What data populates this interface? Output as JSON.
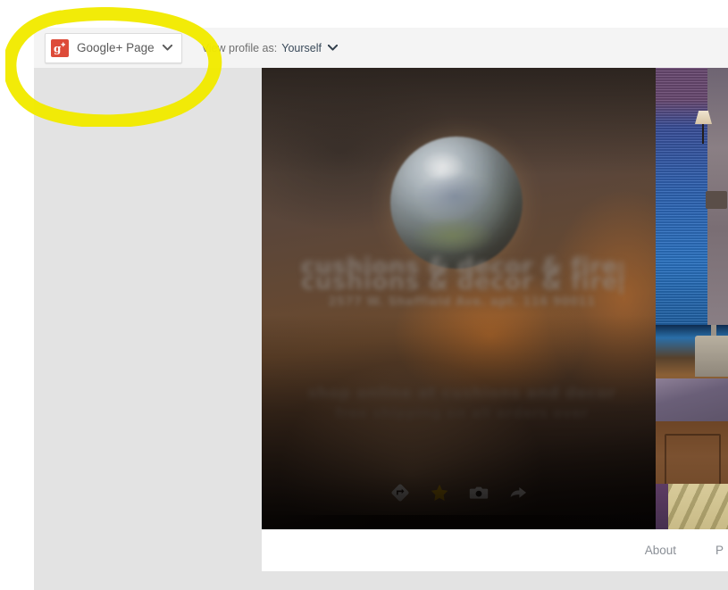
{
  "topbar": {
    "account_chip": {
      "label": "Google+ Page",
      "icon": "google-plus-icon",
      "chevron": "chevron-down-icon"
    },
    "view_profile": {
      "label": "View profile as:",
      "value": "Yourself",
      "chevron": "chevron-down-icon"
    }
  },
  "cover": {
    "watermark_lines": [
      "cushions & decor & fireplaces",
      "cushions & decor & fireplaces",
      "2577 W. Sheffield Ave. apt. 116 90011",
      "shop online at cushions and decor",
      "free shipping on all orders over"
    ],
    "actions": [
      {
        "name": "directions-icon",
        "label": "Directions"
      },
      {
        "name": "star-icon",
        "label": "Review"
      },
      {
        "name": "camera-icon",
        "label": "Photos"
      },
      {
        "name": "share-icon",
        "label": "Share"
      }
    ]
  },
  "nav": {
    "items": [
      {
        "label": "About"
      },
      {
        "label": "P"
      }
    ]
  },
  "colors": {
    "google_plus_red": "#dd4b39",
    "star_gold": "#f0b400",
    "highlight_yellow": "#f2ea00",
    "topbar_bg": "#f4f4f4",
    "page_bg": "#e3e3e3",
    "nav_text": "#8a8f96"
  }
}
